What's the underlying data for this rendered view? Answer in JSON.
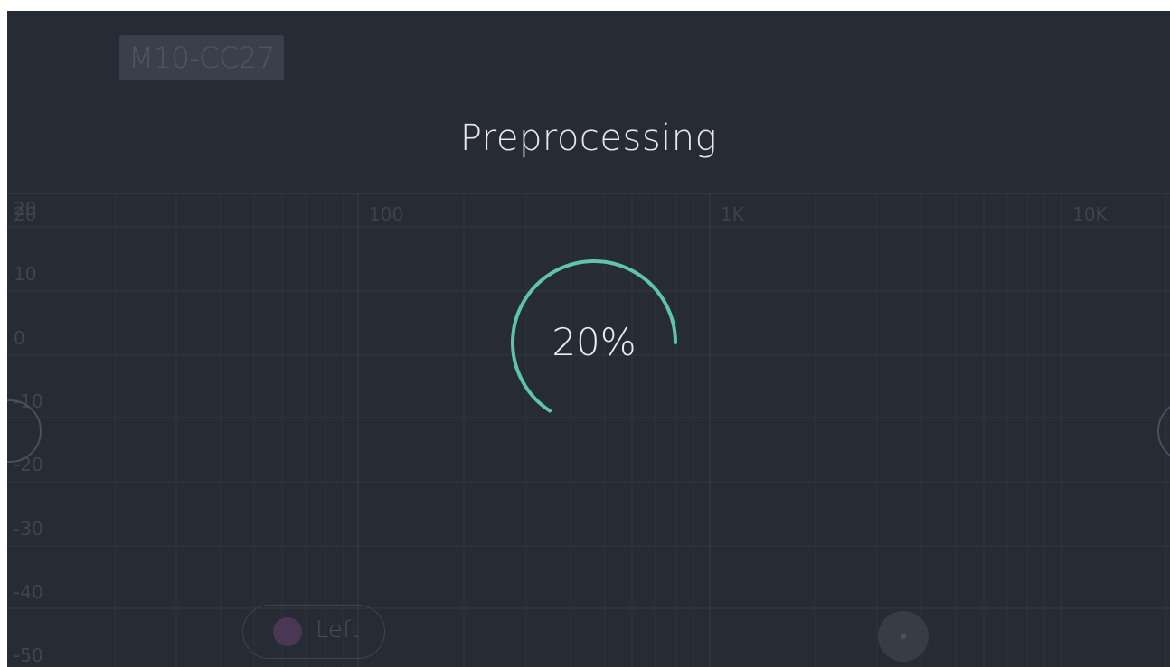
{
  "device": {
    "name": "M10-CC27"
  },
  "overlay": {
    "title": "Preprocessing",
    "progress_text": "20%",
    "progress_fraction": 0.2
  },
  "graph": {
    "y_labels": [
      "20",
      "10",
      "0",
      "-10",
      "-20",
      "-30",
      "-40",
      "-50"
    ],
    "x_labels": [
      "20",
      "100",
      "1K",
      "10K"
    ]
  },
  "channel": {
    "label": "Left"
  },
  "colors": {
    "background": "#262b35",
    "accent": "#5fc4ad",
    "channel_dot": "#4a3655"
  }
}
